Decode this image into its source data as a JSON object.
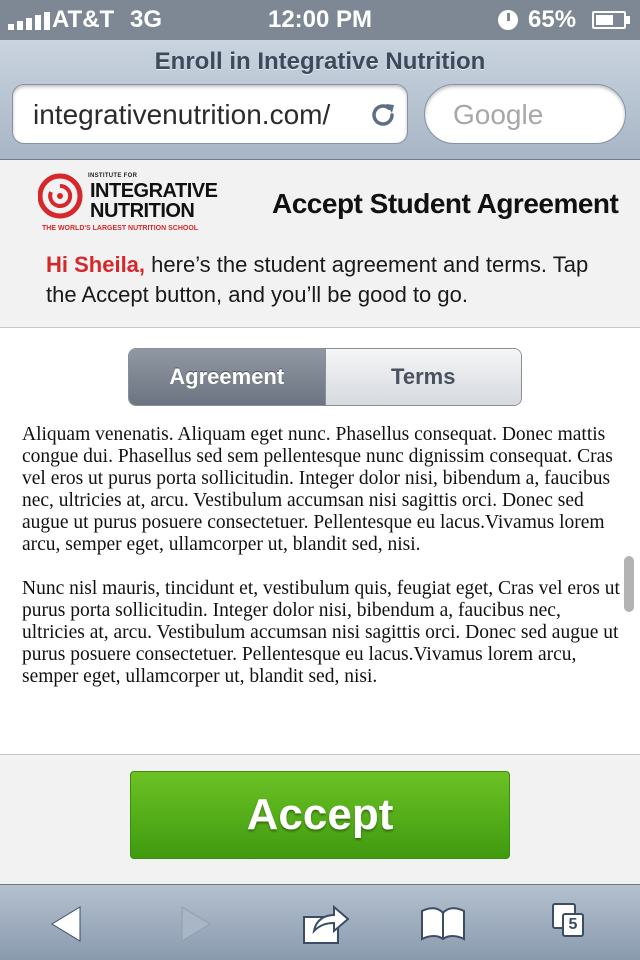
{
  "status_bar": {
    "carrier": "AT&T",
    "network": "3G",
    "time": "12:00 PM",
    "battery": "65%",
    "battery_level": 0.65
  },
  "browser": {
    "page_title": "Enroll in Integrative Nutrition",
    "url": "integrativenutrition.com/",
    "search_placeholder": "Google",
    "tab_count": "5"
  },
  "logo": {
    "small_text": "INSTITUTE FOR",
    "line1": "INTEGRATIVE",
    "line2": "NUTRITION",
    "tagline": "THE WORLD'S LARGEST NUTRITION SCHOOL"
  },
  "header": {
    "title": "Accept Student Agreement",
    "greeting_name": "Hi Sheila,",
    "greeting_text": " here’s the student agreement and terms. Tap the Accept button, and you’ll be good to go."
  },
  "tabs": [
    {
      "label": "Agreement",
      "active": true
    },
    {
      "label": "Terms",
      "active": false
    }
  ],
  "agreement": {
    "paragraphs": [
      "Aliquam venenatis. Aliquam eget nunc. Phasellus consequat. Donec mattis congue dui. Phasellus sed sem pellentesque nunc dignissim consequat. Cras vel eros ut purus porta sollicitudin. Integer dolor nisi, bibendum a, faucibus nec, ultricies at, arcu. Vestibulum accumsan nisi sagittis orci. Donec sed augue ut purus posuere consectetuer. Pellentesque eu lacus.Vivamus lorem arcu, semper eget, ullamcorper ut, blandit sed, nisi.",
      "Nunc nisl mauris, tincidunt et, vestibulum quis, feugiat eget, Cras vel eros ut purus porta sollicitudin. Integer dolor nisi, bibendum a, faucibus nec, ultricies at, arcu. Vestibulum accumsan nisi sagittis orci. Donec sed augue ut purus posuere consectetuer. Pellentesque eu lacus.Vivamus lorem arcu, semper eget, ullamcorper ut, blandit sed, nisi."
    ]
  },
  "accept_button": {
    "label": "Accept"
  },
  "colors": {
    "accent_red": "#d6282b",
    "accept_green": "#4fa816",
    "toolbar": "#9eadbf"
  },
  "icons": {
    "toolbar": [
      "back-arrow-icon",
      "forward-arrow-icon",
      "share-icon",
      "bookmarks-icon",
      "tabs-icon"
    ],
    "url": "reload-icon"
  }
}
